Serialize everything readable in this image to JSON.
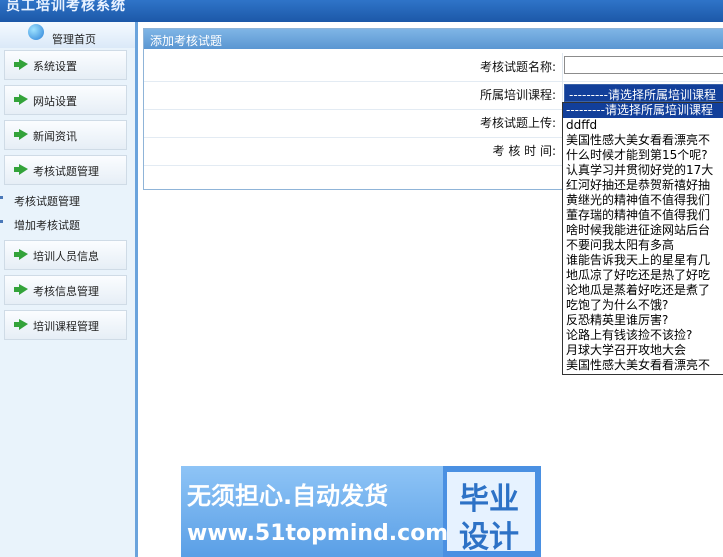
{
  "app": {
    "title": "员工培训考核系统"
  },
  "sidebar": {
    "home_label": "管理首页",
    "items": [
      {
        "label": "系统设置"
      },
      {
        "label": "网站设置"
      },
      {
        "label": "新闻资讯"
      },
      {
        "label": "考核试题管理"
      }
    ],
    "sub_items": [
      {
        "label": "考核试题管理"
      },
      {
        "label": "增加考核试题"
      }
    ],
    "items2": [
      {
        "label": "培训人员信息"
      },
      {
        "label": "考核信息管理"
      },
      {
        "label": "培训课程管理"
      }
    ]
  },
  "form": {
    "title": "添加考核试题",
    "name_label": "考核试题名称:",
    "course_label": "所属培训课程:",
    "upload_label": "考核试题上传:",
    "time_label": "考 核 时 间:",
    "course_selected": "---------请选择所属培训课程"
  },
  "dropdown": {
    "options": [
      "---------请选择所属培训课程",
      "ddffd",
      "美国性感大美女看看漂亮不",
      "什么时候才能到第15个呢?",
      "认真学习并贯彻好党的17大",
      "红河好抽还是恭贺新禧好抽",
      "黄继光的精神值不值得我们",
      "董存瑞的精神值不值得我们",
      "啥时候我能进征途网站后台",
      "不要问我太阳有多高",
      "谁能告诉我天上的星星有几",
      "地瓜凉了好吃还是热了好吃",
      "论地瓜是蒸着好吃还是煮了",
      "吃饱了为什么不饿?",
      "反恐精英里谁厉害?",
      "论路上有钱该捡不该捡?",
      "月球大学召开攻地大会",
      "美国性感大美女看看漂亮不"
    ]
  },
  "banner": {
    "line1": "无须担心.自动发货",
    "line2": "www.51topmind.com",
    "right1": "毕业",
    "right2": "设计"
  }
}
